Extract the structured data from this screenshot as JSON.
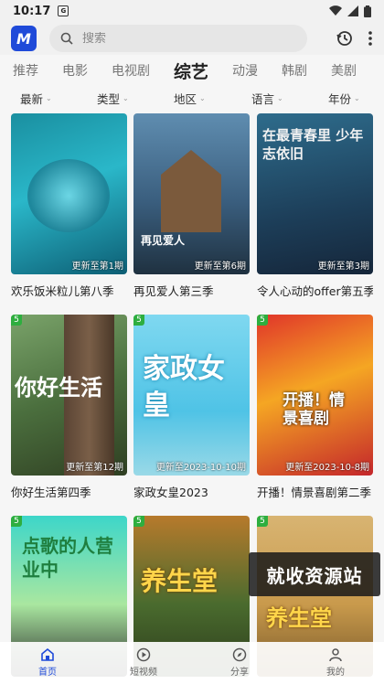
{
  "status": {
    "time": "10:17",
    "notif": "G"
  },
  "header": {
    "logo": "M",
    "search_placeholder": "搜索"
  },
  "categories": [
    "推荐",
    "电影",
    "电视剧",
    "综艺",
    "动漫",
    "韩剧",
    "美剧"
  ],
  "active_category": "综艺",
  "filters": [
    "最新",
    "类型",
    "地区",
    "语言",
    "年份"
  ],
  "cards": [
    {
      "title": "欢乐饭米粒儿第八季",
      "update": "更新至第1期",
      "badge": "",
      "poster": ""
    },
    {
      "title": "再见爱人第三季",
      "update": "更新至第6期",
      "badge": "",
      "poster": "再见爱人"
    },
    {
      "title": "令人心动的offer第五季",
      "update": "更新至第3期",
      "badge": "",
      "poster": "在最青春里 少年志依旧"
    },
    {
      "title": "你好生活第四季",
      "update": "更新至第12期",
      "badge": "5",
      "poster": "你好生活"
    },
    {
      "title": "家政女皇2023",
      "update": "更新至2023-10-10期",
      "badge": "5",
      "poster": "家政女皇"
    },
    {
      "title": "开播！情景喜剧第二季",
      "update": "更新至2023-10-8期",
      "badge": "5",
      "poster": "开播！情景喜剧"
    },
    {
      "title": "",
      "update": "",
      "badge": "5",
      "poster": "点歌的人营业中"
    },
    {
      "title": "",
      "update": "",
      "badge": "5",
      "poster": "养生堂"
    },
    {
      "title": "",
      "update": "",
      "badge": "5",
      "poster": "养生堂"
    }
  ],
  "watermark": "就收资源站",
  "nav": [
    {
      "label": "首页",
      "icon": "home-icon"
    },
    {
      "label": "短视频",
      "icon": "play-icon"
    },
    {
      "label": "分享",
      "icon": "compass-icon"
    },
    {
      "label": "我的",
      "icon": "user-icon"
    }
  ],
  "colors": {
    "accent": "#1f4ad9",
    "badge": "#2eae3f"
  }
}
